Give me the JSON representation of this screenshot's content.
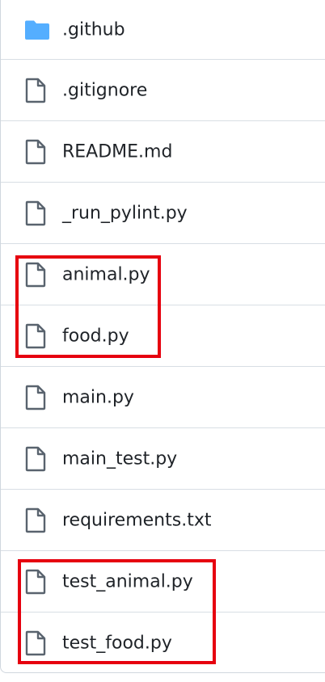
{
  "file_list": {
    "items": [
      {
        "name": ".github",
        "type": "folder",
        "icon": "folder-icon"
      },
      {
        "name": ".gitignore",
        "type": "file",
        "icon": "file-icon"
      },
      {
        "name": "README.md",
        "type": "file",
        "icon": "file-icon"
      },
      {
        "name": "_run_pylint.py",
        "type": "file",
        "icon": "file-icon"
      },
      {
        "name": "animal.py",
        "type": "file",
        "icon": "file-icon"
      },
      {
        "name": "food.py",
        "type": "file",
        "icon": "file-icon"
      },
      {
        "name": "main.py",
        "type": "file",
        "icon": "file-icon"
      },
      {
        "name": "main_test.py",
        "type": "file",
        "icon": "file-icon"
      },
      {
        "name": "requirements.txt",
        "type": "file",
        "icon": "file-icon"
      },
      {
        "name": "test_animal.py",
        "type": "file",
        "icon": "file-icon"
      },
      {
        "name": "test_food.py",
        "type": "file",
        "icon": "file-icon"
      }
    ]
  },
  "annotations": {
    "highlight_color": "#e6000f",
    "highlighted_groups": [
      [
        "animal.py",
        "food.py"
      ],
      [
        "test_animal.py",
        "test_food.py"
      ]
    ]
  },
  "colors": {
    "folder": "#54aeff",
    "file_icon": "#59636e",
    "text": "#1f2328",
    "divider": "#d8dee4"
  }
}
